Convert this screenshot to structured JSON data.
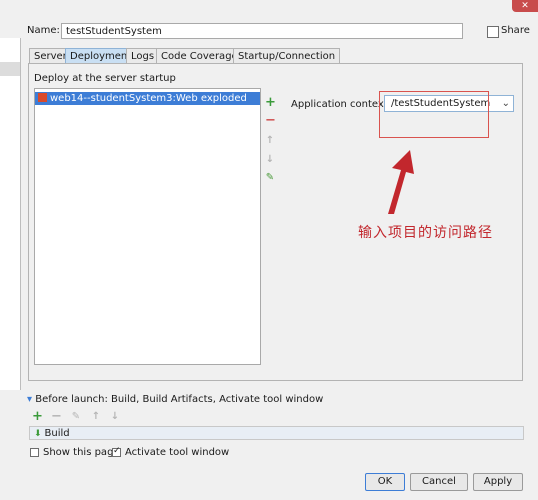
{
  "window": {
    "close_glyph": "✕"
  },
  "name": {
    "label": "Name:",
    "value": "testStudentSystem"
  },
  "share": {
    "label": "Share",
    "checked": false
  },
  "tabs": [
    {
      "label": "Server"
    },
    {
      "label": "Deployment"
    },
    {
      "label": "Logs"
    },
    {
      "label": "Code Coverage"
    },
    {
      "label": "Startup/Connection"
    }
  ],
  "deployment": {
    "section_label": "Deploy at the server startup",
    "items": [
      {
        "label": "web14--studentSystem3:Web exploded"
      }
    ],
    "app_context_label": "Application context:",
    "app_context_value": "/testStudentSystem"
  },
  "annotation": {
    "text": "输入项目的访问路径",
    "color": "#c2272d"
  },
  "before_launch": {
    "label": "Before launch: Build, Build Artifacts, Activate tool window",
    "items": [
      {
        "label": "Build"
      }
    ],
    "show_this_page": "Show this page",
    "activate_tool_window": "Activate tool window"
  },
  "buttons": {
    "ok": "OK",
    "cancel": "Cancel",
    "apply": "Apply"
  }
}
